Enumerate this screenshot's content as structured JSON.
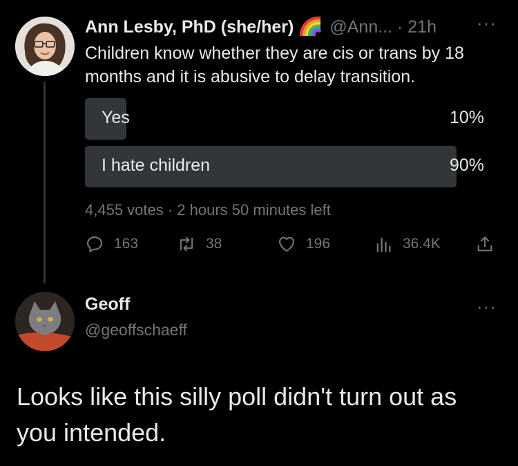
{
  "tweet": {
    "author_name": "Ann Lesby, PhD (she/her)",
    "handle_time": "@Ann... · 21h",
    "more": "···",
    "text": "Children know whether they are cis or trans by 18 months and it is abusive to delay transition.",
    "poll": {
      "options": [
        {
          "label": "Yes",
          "percent_text": "10%",
          "share": 0.1
        },
        {
          "label": "I hate children",
          "percent_text": "90%",
          "share": 0.9
        }
      ],
      "meta": "4,455 votes · 2 hours 50 minutes left"
    },
    "actions": {
      "replies": "163",
      "retweets": "38",
      "likes": "196",
      "views": "36.4K"
    }
  },
  "reply": {
    "author_name": "Geoff",
    "handle": "@geoffschaeff",
    "more": "···",
    "text": "Looks like this silly poll didn't turn out as you intended."
  },
  "colors": {
    "background": "#000000",
    "text_primary": "#e7e9ea",
    "text_secondary": "#71767b",
    "poll_fill": "#333639"
  }
}
